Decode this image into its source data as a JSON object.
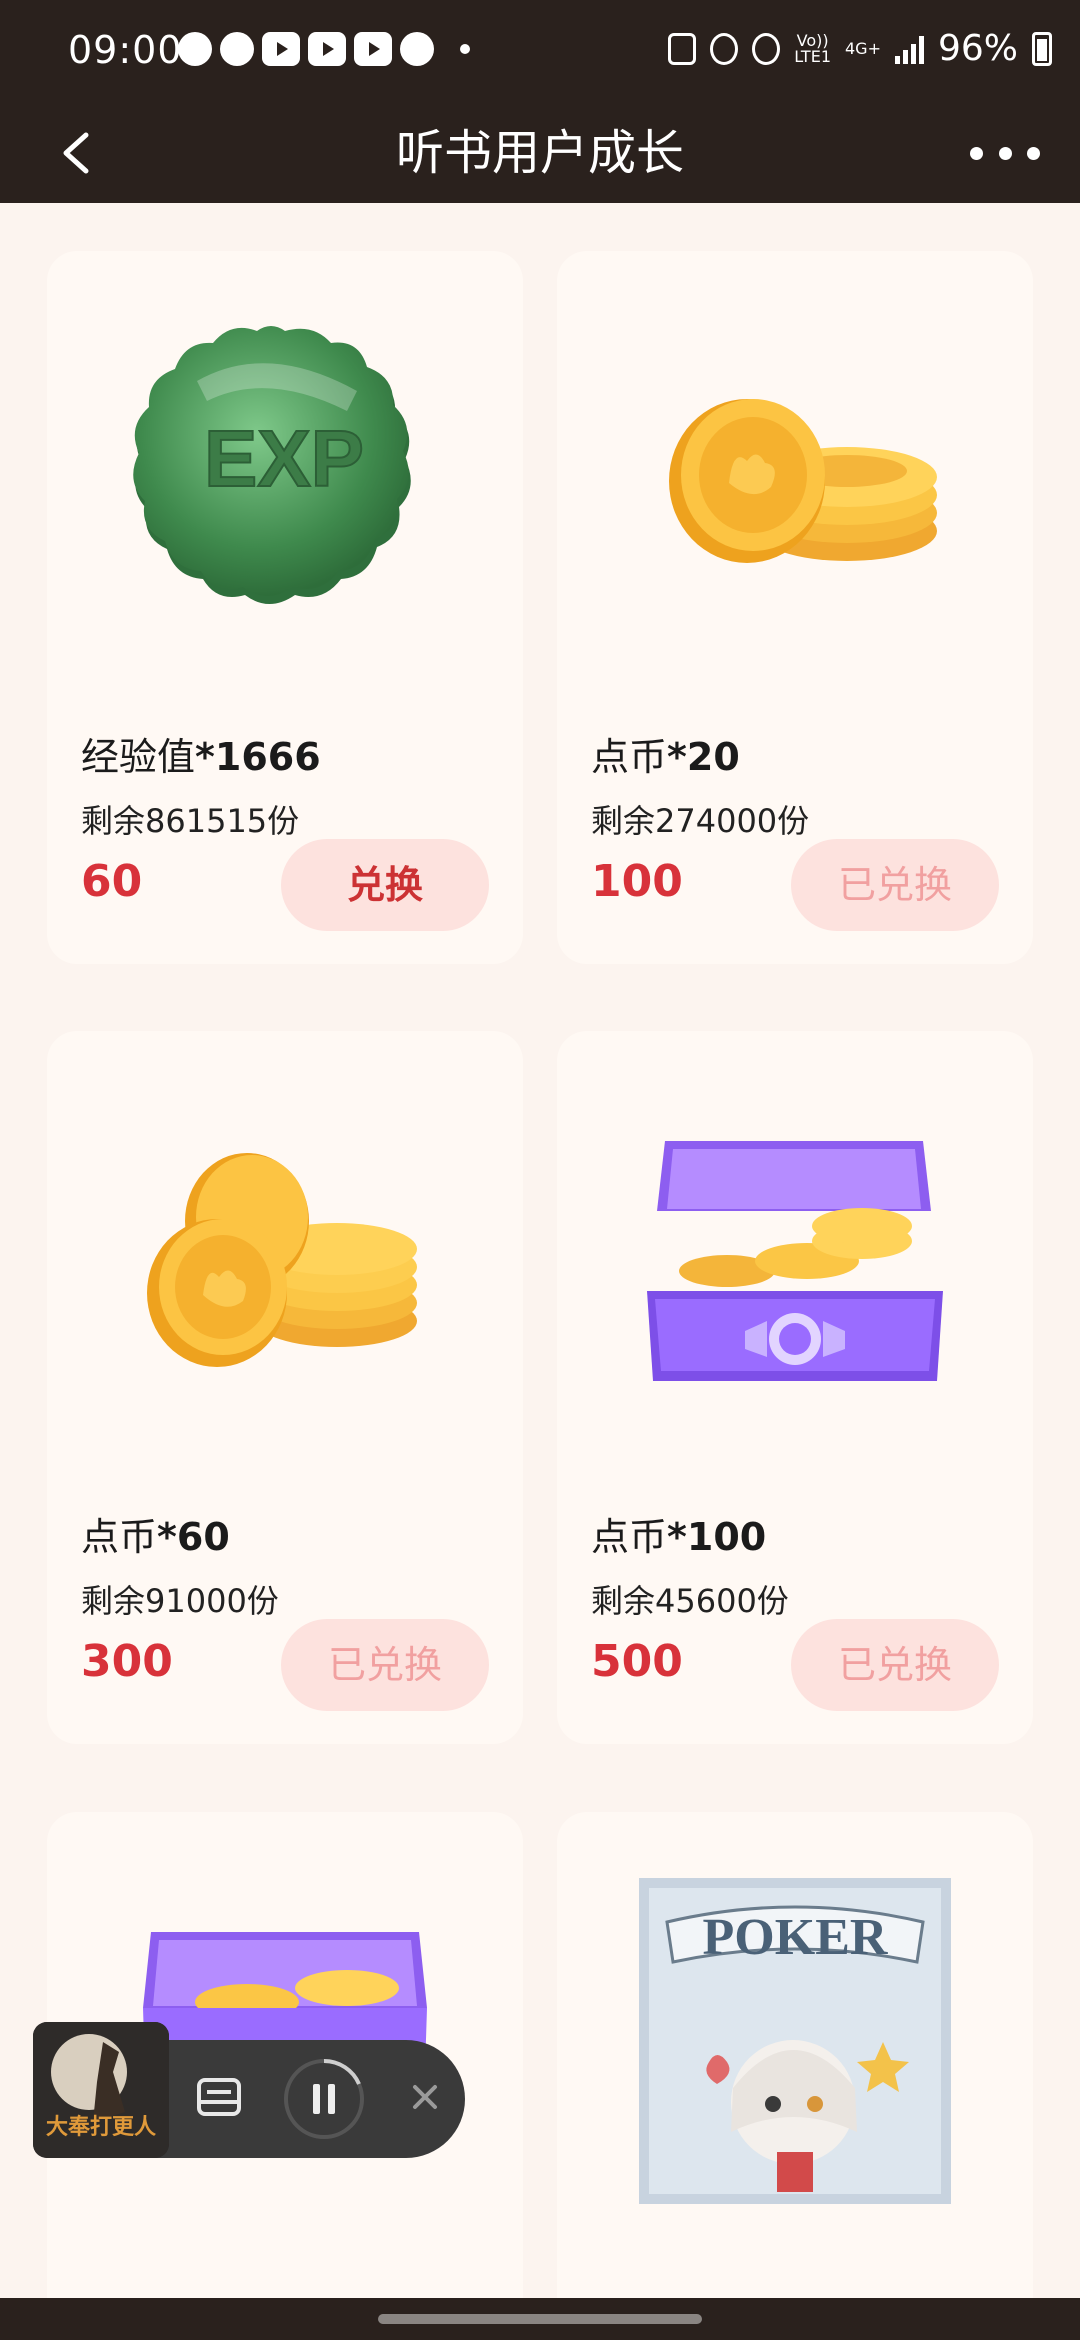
{
  "status": {
    "time": "09:00",
    "battery": "96%",
    "network_lte": "LTE1",
    "network_4g": "4G+",
    "volte": "Vo))"
  },
  "header": {
    "title": "听书用户成长"
  },
  "rewards": [
    {
      "name_prefix": "经验值",
      "name_suffix": "*1666",
      "remain": "剩余861515份",
      "price": "60",
      "button": "兑换"
    },
    {
      "name_prefix": "点币",
      "name_suffix": "*20",
      "remain": "剩余274000份",
      "price": "100",
      "button": "已兑换"
    },
    {
      "name_prefix": "点币",
      "name_suffix": "*60",
      "remain": "剩余91000份",
      "price": "300",
      "button": "已兑换"
    },
    {
      "name_prefix": "点币",
      "name_suffix": "*100",
      "remain": "剩余45600份",
      "price": "500",
      "button": "已兑换"
    }
  ],
  "images": {
    "exp_badge": "EXP",
    "poker_card": "POKER"
  },
  "player": {
    "cover_title": "大奉打更人"
  },
  "colors": {
    "header_bg": "#2a211d",
    "page_bg": "#fcf4ef",
    "card_bg": "#fff9f4",
    "price": "#d8323a",
    "button_bg": "#fde2de",
    "button_active": "#cc3234",
    "button_done": "#f1a0a0"
  }
}
